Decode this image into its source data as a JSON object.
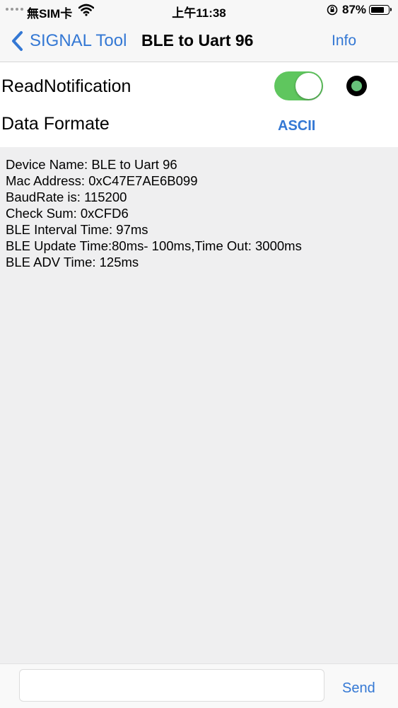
{
  "status_bar": {
    "carrier": "無SIM卡",
    "time": "上午11:38",
    "battery_percent": "87%",
    "battery_level": 0.87
  },
  "nav": {
    "back_label": "SIGNAL Tool",
    "title": "BLE to Uart 96",
    "info_label": "Info"
  },
  "controls": {
    "read_notification_label": "ReadNotification",
    "read_notification_on": true,
    "data_format_label": "Data Formate",
    "data_format_value": "ASCII",
    "indicator_color": "#67c27b"
  },
  "log": {
    "lines": [
      "Device Name: BLE to Uart 96",
      "Mac Address: 0xC47E7AE6B099",
      "BaudRate is: 115200",
      "Check Sum: 0xCFD6",
      "BLE Interval Time: 97ms",
      "BLE Update Time:80ms- 100ms,Time Out: 3000ms",
      "BLE ADV Time: 125ms"
    ]
  },
  "bottom": {
    "input_value": "",
    "send_label": "Send"
  },
  "colors": {
    "accent": "#3478d4",
    "toggle_on": "#5fc65e",
    "log_background": "#efeff0"
  }
}
